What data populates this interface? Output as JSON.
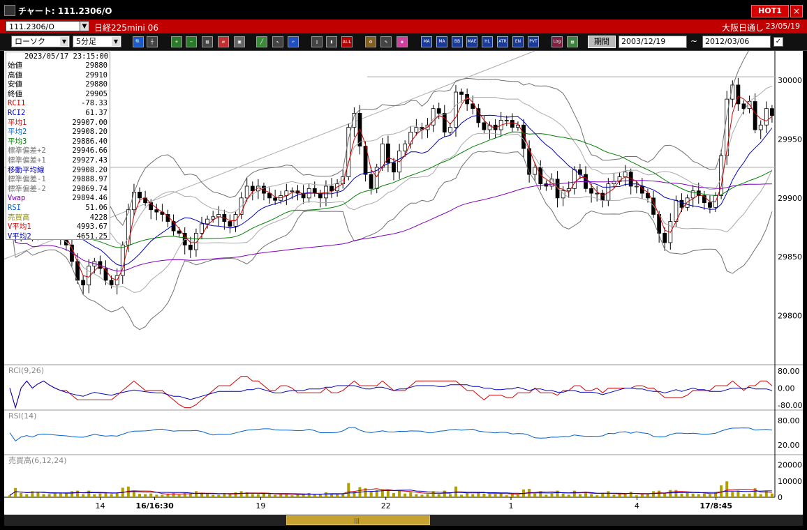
{
  "window": {
    "title": "チャート: 111.2306/O",
    "hot_label": "HOT1",
    "close_label": "×"
  },
  "symbol_row": {
    "code": "111.2306/O",
    "instrument": "日経225mini 06",
    "exchange": "大阪日通し",
    "date": "23/05/19"
  },
  "toolbar": {
    "chart_type": "ローソク",
    "interval": "5分足",
    "period_label": "期間",
    "date_from": "2003/12/19",
    "tilde": "~",
    "date_to": "2012/03/06",
    "check": "✓",
    "text_buttons": [
      "MA",
      "MA",
      "BB",
      "MAE",
      "HL",
      "ATR",
      "EN",
      "PVT",
      "Log"
    ],
    "alert_label": "ALL"
  },
  "info": {
    "timestamp": "2023/05/17 23:15:00",
    "rows": [
      {
        "label": "始値",
        "value": "29880",
        "color": "#000000"
      },
      {
        "label": "高値",
        "value": "29910",
        "color": "#000000"
      },
      {
        "label": "安値",
        "value": "29880",
        "color": "#000000"
      },
      {
        "label": "終値",
        "value": "29905",
        "color": "#000000"
      },
      {
        "label": "RCI1",
        "value": "-78.33",
        "color": "#d00000"
      },
      {
        "label": "RCI2",
        "value": "61.37",
        "color": "#0000c0"
      },
      {
        "label": "平均1",
        "value": "29907.00",
        "color": "#d00000"
      },
      {
        "label": "平均2",
        "value": "29908.20",
        "color": "#0060d0"
      },
      {
        "label": "平均3",
        "value": "29886.40",
        "color": "#008000"
      },
      {
        "label": "標準偏差+2",
        "value": "29946.66",
        "color": "#707070"
      },
      {
        "label": "標準偏差+1",
        "value": "29927.43",
        "color": "#707070"
      },
      {
        "label": "移動平均線",
        "value": "29908.20",
        "color": "#0000c0"
      },
      {
        "label": "標準偏差-1",
        "value": "29888.97",
        "color": "#707070"
      },
      {
        "label": "標準偏差-2",
        "value": "29869.74",
        "color": "#707070"
      },
      {
        "label": "Vwap",
        "value": "29894.46",
        "color": "#8000c0"
      },
      {
        "label": "RSI",
        "value": "51.06",
        "color": "#0060d0"
      },
      {
        "label": "売買高",
        "value": "4228",
        "color": "#909000"
      },
      {
        "label": "V平均1",
        "value": "4993.67",
        "color": "#d00000"
      },
      {
        "label": "V平均2",
        "value": "4651.25",
        "color": "#0000c0"
      }
    ]
  },
  "chart_data": {
    "type": "candlestick",
    "price_axis": {
      "ticks": [
        "30000",
        "29950",
        "29900",
        "29850",
        "29800"
      ],
      "range": [
        29760,
        30025
      ]
    },
    "rci_panel": {
      "title": "RCI(9,26)",
      "ticks": [
        "80.00",
        "0.00",
        "-80.00"
      ],
      "range": [
        -100,
        100
      ]
    },
    "rsi_panel": {
      "title": "RSI(14)",
      "ticks": [
        "80.00",
        "20.00"
      ],
      "range": [
        0,
        100
      ]
    },
    "volume_panel": {
      "title": "売買高(6,12,24)",
      "ticks": [
        "20000",
        "10000",
        "0"
      ],
      "range": [
        0,
        25000
      ]
    },
    "x_labels": [
      {
        "label": "14",
        "bold": false,
        "pos": 0.125
      },
      {
        "label": "16/16:30",
        "bold": true,
        "pos": 0.196
      },
      {
        "label": "19",
        "bold": false,
        "pos": 0.334
      },
      {
        "label": "22",
        "bold": false,
        "pos": 0.497
      },
      {
        "label": "1",
        "bold": false,
        "pos": 0.66
      },
      {
        "label": "4",
        "bold": false,
        "pos": 0.824
      },
      {
        "label": "17/8:45",
        "bold": true,
        "pos": 0.927
      }
    ],
    "close_series": [
      29895,
      29870,
      29878,
      29882,
      29868,
      29880,
      29884,
      29880,
      29874,
      29866,
      29860,
      29846,
      29830,
      29826,
      29842,
      29846,
      29840,
      29830,
      29826,
      29834,
      29860,
      29890,
      29905,
      29900,
      29896,
      29890,
      29888,
      29886,
      29880,
      29872,
      29870,
      29860,
      29856,
      29870,
      29878,
      29882,
      29884,
      29886,
      29880,
      29876,
      29886,
      29900,
      29910,
      29906,
      29910,
      29904,
      29900,
      29898,
      29902,
      29906,
      29906,
      29904,
      29900,
      29908,
      29904,
      29900,
      29910,
      29906,
      29912,
      29918,
      29960,
      29972,
      29944,
      29920,
      29908,
      29926,
      29946,
      29930,
      29922,
      29940,
      29946,
      29956,
      29960,
      29958,
      29962,
      29976,
      29972,
      29956,
      29960,
      29990,
      29988,
      29980,
      29976,
      29964,
      29958,
      29962,
      29958,
      29966,
      29966,
      29960,
      29962,
      29942,
      29920,
      29926,
      29912,
      29910,
      29916,
      29900,
      29906,
      29908,
      29924,
      29920,
      29908,
      29904,
      29904,
      29898,
      29912,
      29914,
      29918,
      29922,
      29910,
      29910,
      29904,
      29900,
      29886,
      29870,
      29862,
      29880,
      29898,
      29892,
      29900,
      29906,
      29902,
      29896,
      29892,
      29902,
      29936,
      29984,
      29996,
      29980,
      29976,
      29982,
      29958,
      29962,
      29976,
      29970
    ]
  },
  "scrollbar": {
    "grip": "|||"
  },
  "colors": {
    "candle_up": "#ffffff",
    "candle_down": "#000000",
    "ma1": "#d00000",
    "ma2": "#0000c0",
    "ma3": "#008000",
    "bands": "#707070",
    "vwap": "#8000c0",
    "rci1": "#d00000",
    "rci2": "#0000c0",
    "rsi": "#0060d0",
    "volume": "#b0a000"
  }
}
